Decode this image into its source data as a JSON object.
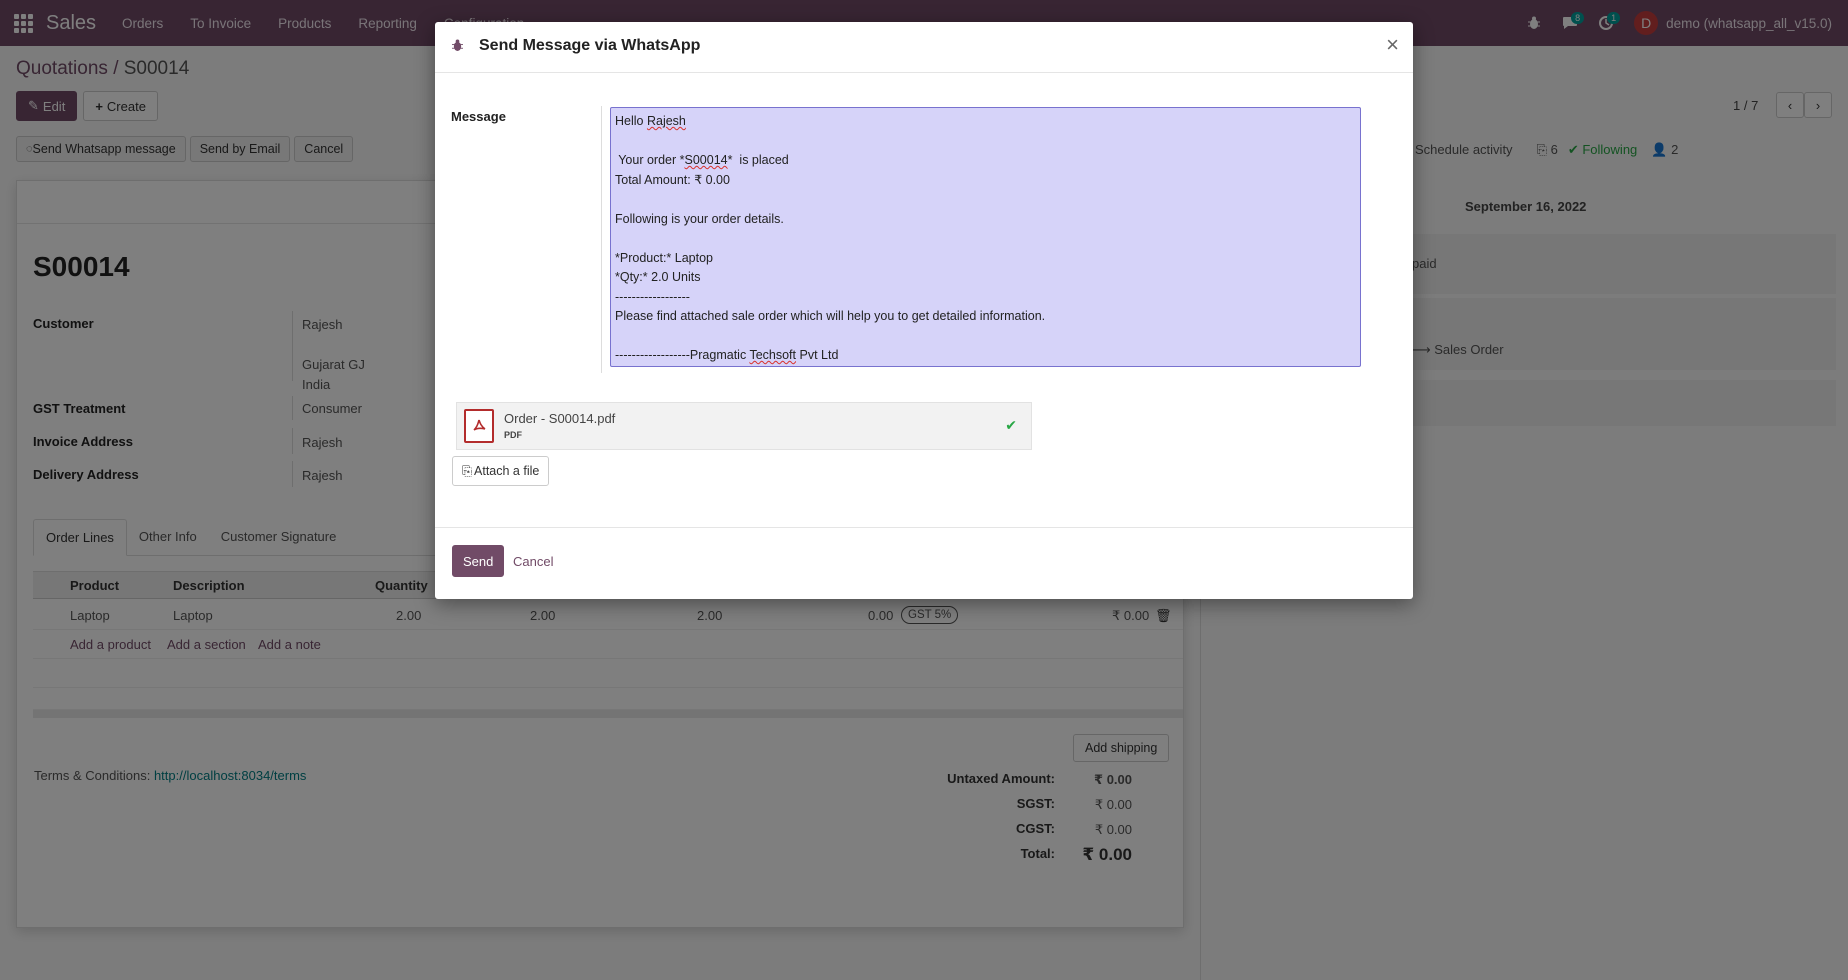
{
  "navbar": {
    "app_name": "Sales",
    "menu": [
      "Orders",
      "To Invoice",
      "Products",
      "Reporting",
      "Configuration"
    ],
    "messages_count": "8",
    "activities_count": "1",
    "avatar_letter": "D",
    "user": "demo (whatsapp_all_v15.0)"
  },
  "breadcrumb": {
    "parent": "Quotations",
    "separator": "/",
    "current": "S00014"
  },
  "control": {
    "edit_label": "Edit",
    "create_label": "Create",
    "pager": "1 / 7"
  },
  "statusbar": {
    "whatsapp_label": "Send Whatsapp message",
    "email_label": "Send by Email",
    "cancel_label": "Cancel"
  },
  "chatter": {
    "schedule_activity": "Schedule activity",
    "attachments_count": "6",
    "following_label": "Following",
    "followers_count": "2",
    "date": "September 16, 2022",
    "snippet_paid": "paid",
    "snippet_order": "Sales Order"
  },
  "form": {
    "name": "S00014",
    "customer_label": "Customer",
    "customer_name": "Rajesh",
    "customer_addr1": "Gujarat GJ",
    "customer_addr2": "India",
    "gst_label": "GST Treatment",
    "gst_value": "Consumer",
    "invoice_label": "Invoice Address",
    "invoice_value": "Rajesh",
    "delivery_label": "Delivery Address",
    "delivery_value": "Rajesh",
    "tabs": [
      "Order Lines",
      "Other Info",
      "Customer Signature"
    ],
    "columns": {
      "product": "Product",
      "description": "Description",
      "quantity": "Quantity"
    },
    "line": {
      "product": "Laptop",
      "description": "Laptop",
      "qty": "2.00",
      "delivered": "2.00",
      "invoiced": "2.00",
      "price": "0.00",
      "tax": "GST 5%",
      "subtotal": "₹ 0.00"
    },
    "add_product": "Add a product",
    "add_section": "Add a section",
    "add_note": "Add a note",
    "add_shipping": "Add shipping",
    "terms_label": "Terms & Conditions:",
    "terms_link": "http://localhost:8034/terms",
    "totals": {
      "untaxed_label": "Untaxed Amount:",
      "untaxed_value": "₹ 0.00",
      "sgst_label": "SGST:",
      "sgst_value": "₹ 0.00",
      "cgst_label": "CGST:",
      "cgst_value": "₹ 0.00",
      "total_label": "Total:",
      "total_value": "₹ 0.00"
    }
  },
  "modal": {
    "title": "Send Message via WhatsApp",
    "close": "×",
    "message_label": "Message",
    "message_lines": {
      "l1a": "Hello ",
      "l1b": "Rajesh",
      "l2": "",
      "l3a": " Your order *",
      "l3b": "S00014",
      "l3c": "*  is placed",
      "l4": "Total Amount: ₹ 0.00",
      "l5": "",
      "l6": "Following is your order details.",
      "l7": "",
      "l8": "*Product:* Laptop",
      "l9": "*Qty:* 2.0 Units",
      "l10": "------------------",
      "l11": "Please find attached sale order which will help you to get detailed information.",
      "l12": "",
      "l13a": "------------------Pragmatic ",
      "l13b": "Techsoft",
      "l13c": " Pvt Ltd"
    },
    "attachment_name": "Order - S00014.pdf",
    "attachment_ext": "PDF",
    "attach_label": "Attach a file",
    "send_label": "Send",
    "cancel_label": "Cancel"
  },
  "colors": {
    "brand": "#714b67",
    "accent": "#00a09d",
    "highlight": "#d6d3f9",
    "success": "#28a745"
  },
  "icons": [
    "apps-grid-icon",
    "bug-icon",
    "messages-icon",
    "activity-clock-icon",
    "pencil-icon",
    "plus-icon",
    "whatsapp-icon",
    "chevron-left-icon",
    "chevron-right-icon",
    "paperclip-icon",
    "check-icon",
    "user-icon",
    "trash-icon",
    "pdf-file-icon",
    "close-icon"
  ]
}
